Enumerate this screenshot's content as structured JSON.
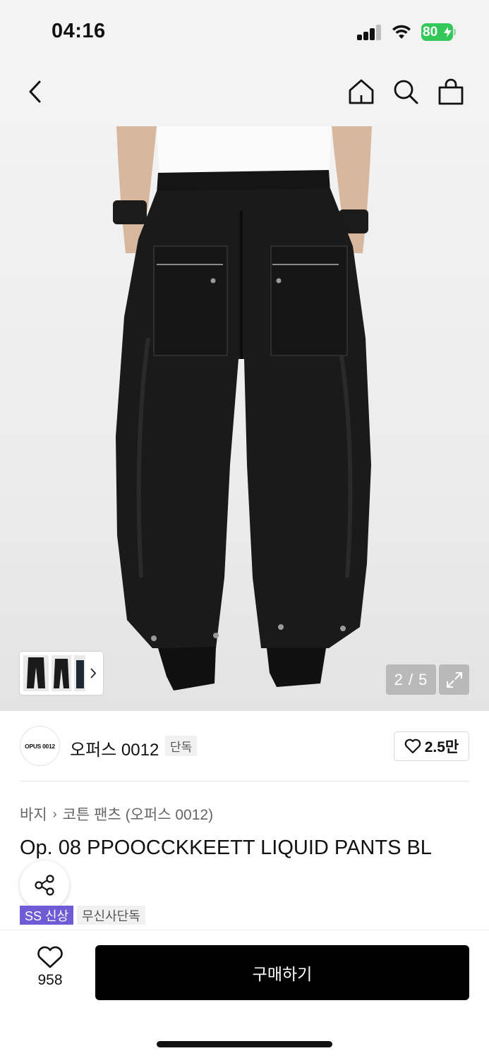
{
  "status_bar": {
    "time": "04:16",
    "battery_level": "80",
    "signal_bars": 4,
    "icons": [
      "cellular-signal-icon",
      "wifi-icon",
      "battery-charging-icon"
    ]
  },
  "header": {
    "icons": [
      "back-chevron-icon",
      "home-icon",
      "search-icon",
      "shopping-bag-icon"
    ]
  },
  "gallery": {
    "current_page": "2",
    "total_pages": "5",
    "page_label": "2 / 5",
    "image_subject": "black wide-leg cargo pants, back view"
  },
  "brand": {
    "logo_text": "OPUS 0012",
    "name": "오퍼스 0012",
    "badge": "단독",
    "likes": "2.5만"
  },
  "product": {
    "breadcrumb": [
      "바지",
      "코튼 팬츠 (오퍼스 0012)"
    ],
    "title": "Op. 08 PPOOCCKKEETT LIQUID PANTS BL",
    "tags": [
      "SS 신상",
      "무신사단독"
    ]
  },
  "bottom_bar": {
    "like_count": "958",
    "buy_label": "구매하기"
  },
  "colors": {
    "accent_tag": "#6f5bd4",
    "buy_button": "#000000",
    "battery": "#34c759"
  }
}
